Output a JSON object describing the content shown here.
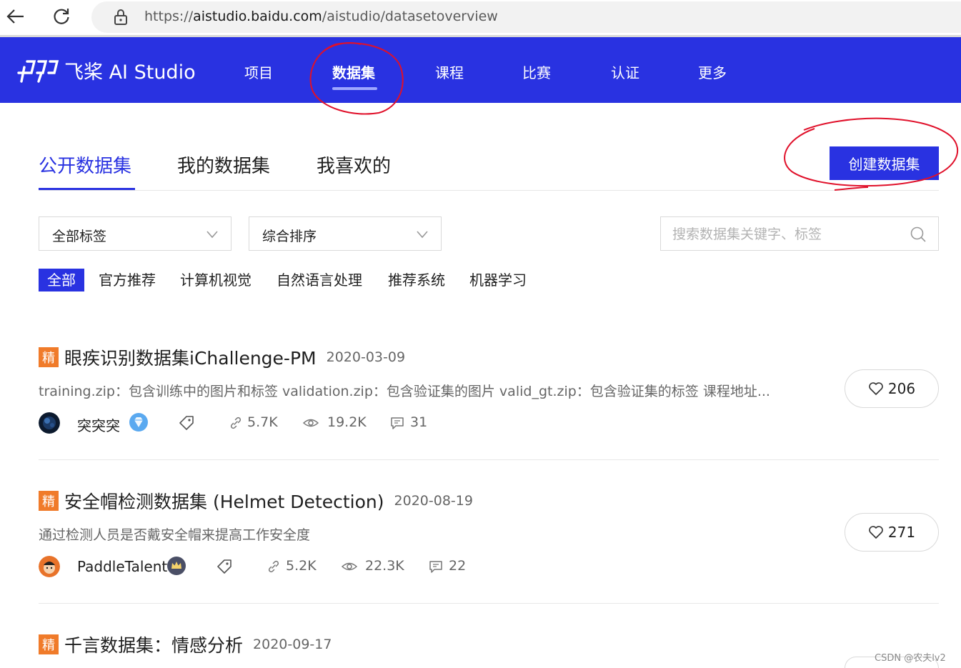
{
  "browser": {
    "url_scheme": "https://",
    "url_host": "aistudio.baidu.com",
    "url_path": "/aistudio/datasetoverview"
  },
  "header": {
    "logo_text": "飞桨 AI Studio",
    "nav": [
      "项目",
      "数据集",
      "课程",
      "比赛",
      "认证",
      "更多"
    ],
    "active_nav": "数据集"
  },
  "tabs": {
    "items": [
      "公开数据集",
      "我的数据集",
      "我喜欢的"
    ],
    "active": "公开数据集",
    "create_button": "创建数据集"
  },
  "filters": {
    "tag_select": "全部标签",
    "sort_select": "综合排序",
    "search_placeholder": "搜索数据集关键字、标签"
  },
  "tag_chips": [
    "全部",
    "官方推荐",
    "计算机视觉",
    "自然语言处理",
    "推荐系统",
    "机器学习"
  ],
  "datasets": [
    {
      "badge": "精",
      "title": "眼疾识别数据集iChallenge-PM",
      "date": "2020-03-09",
      "desc": "training.zip：包含训练中的图片和标签 validation.zip：包含验证集的图片 valid_gt.zip：包含验证集的标签 课程地址...",
      "author": "突突突",
      "links": "5.7K",
      "views": "19.2K",
      "comments": "31",
      "likes": "206"
    },
    {
      "badge": "精",
      "title": "安全帽检测数据集 (Helmet Detection)",
      "date": "2020-08-19",
      "desc": "通过检测人员是否戴安全帽来提高工作安全度",
      "author": "PaddleTalent",
      "links": "5.2K",
      "views": "22.3K",
      "comments": "22",
      "likes": "271"
    },
    {
      "badge": "精",
      "title": "千言数据集：情感分析",
      "date": "2020-09-17"
    }
  ],
  "watermark": "CSDN @农夫lv2",
  "colors": {
    "brand": "#2932e1",
    "badge": "#f07b2a",
    "annotation": "#e0102a"
  }
}
